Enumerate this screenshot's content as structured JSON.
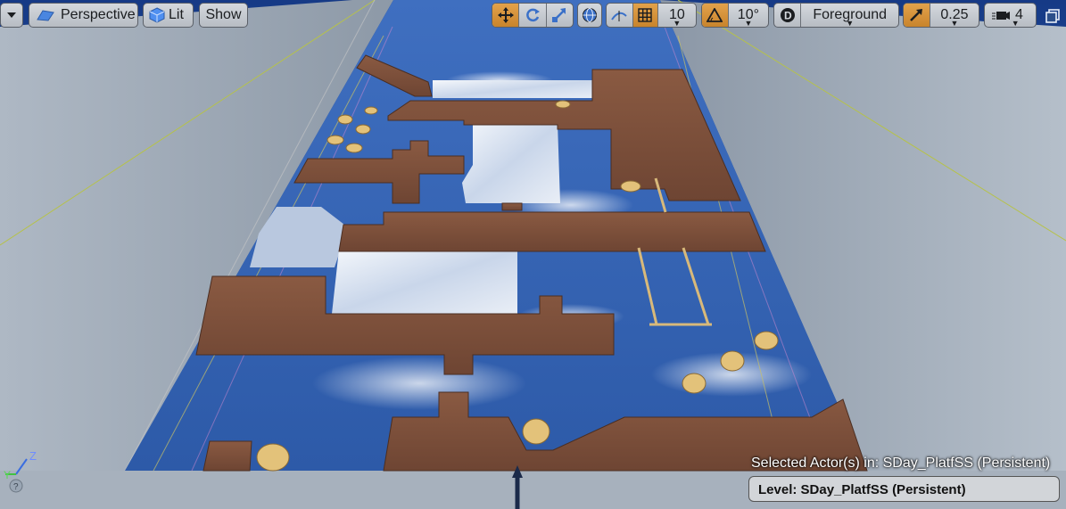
{
  "toolbar": {
    "menu_icon": "chevron-down-icon",
    "view_mode_label": "Perspective",
    "lit_label": "Lit",
    "show_label": "Show",
    "grid_snap_value": "10",
    "rotation_snap_value": "10°",
    "layer_label": "Foreground",
    "scale_snap_value": "0.25",
    "camera_speed_value": "4",
    "accent_color": "#c8842c"
  },
  "status": {
    "selected_actor_text": "Selected Actor(s) in:  SDay_PlatfSS (Persistent)",
    "level_label": "Level:  SDay_PlatfSS (Persistent)"
  },
  "axis_gizmo": {
    "z_label": "Z",
    "y_label": "Y"
  }
}
